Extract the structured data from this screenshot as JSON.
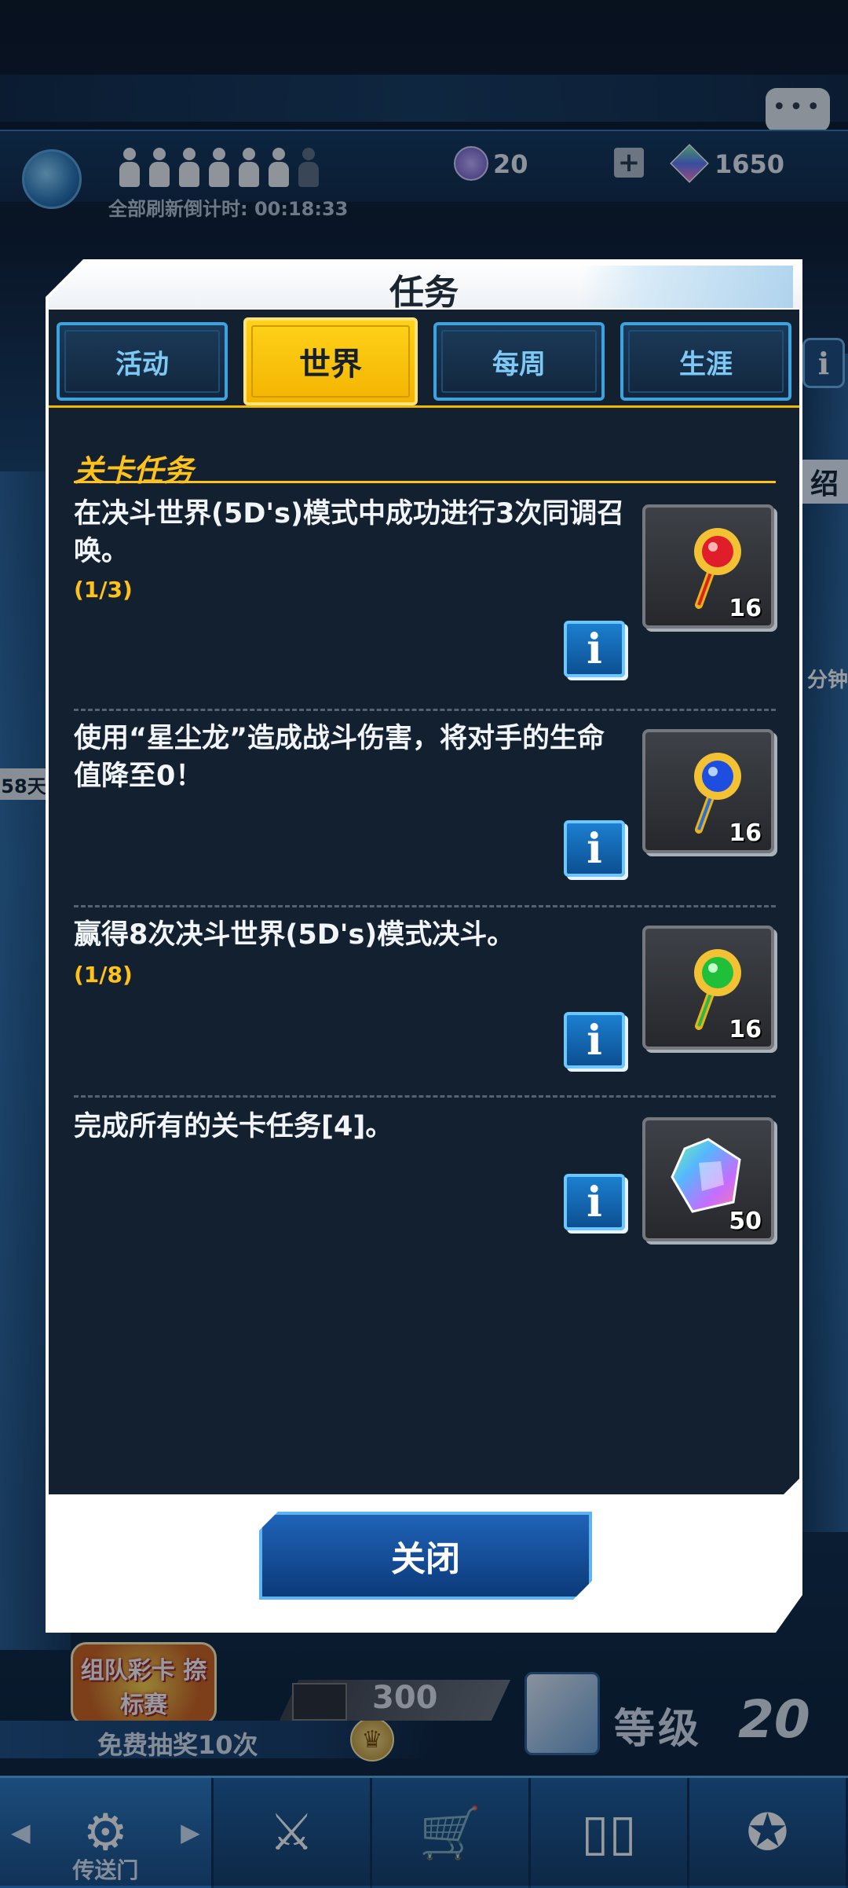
{
  "header": {
    "refresh_label": "全部刷新倒计时: ",
    "refresh_time": "00:18:33",
    "stamina_value": "20",
    "gem_value": "1650"
  },
  "side": {
    "intro_glyph": "绍",
    "minute_glyph": "分钟",
    "days_peek": "58天"
  },
  "modal": {
    "title": "任务",
    "tabs": [
      {
        "label": "活动",
        "active": false
      },
      {
        "label": "世界",
        "active": true
      },
      {
        "label": "每周",
        "active": false
      },
      {
        "label": "生涯",
        "active": false
      }
    ],
    "section_title": "关卡任务",
    "missions": [
      {
        "text": "在决斗世界(5D's)模式中成功进行3次同调召唤。",
        "progress": "(1/3)",
        "reward_icon": "red-key-icon",
        "reward_count": "16"
      },
      {
        "text": "使用“星尘龙”造成战斗伤害，将对手的生命值降至0！",
        "progress": "",
        "reward_icon": "blue-key-icon",
        "reward_count": "16"
      },
      {
        "text": "赢得8次决斗世界(5D's)模式决斗。",
        "progress": "(1/8)",
        "reward_icon": "green-key-icon",
        "reward_count": "16"
      },
      {
        "text": "完成所有的关卡任务[4]。",
        "progress": "",
        "reward_icon": "rainbow-gem-icon",
        "reward_count": "50"
      }
    ],
    "info_glyph": "i",
    "close_label": "关闭"
  },
  "bottom": {
    "event_label": "组队彩卡 捺标赛",
    "free_draw_label": "免费抽奖10次",
    "ticket_value": "300",
    "level_label": "等级",
    "level_value": "20",
    "nav_gate_label": "传送门"
  },
  "colors": {
    "accent_yellow": "#ffc21a",
    "panel_bg": "#13202f",
    "tab_border": "#3ba3df",
    "info_blue": "#1c7fd0"
  }
}
